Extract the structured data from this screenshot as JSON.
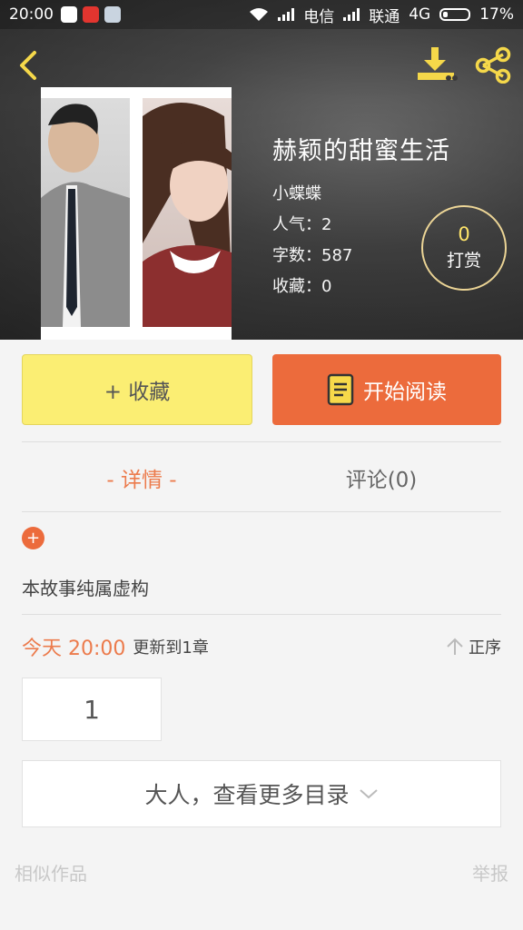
{
  "status_bar": {
    "time": "20:00",
    "carrier1": "电信",
    "carrier2": "联通",
    "network": "4G",
    "battery": "17%"
  },
  "book": {
    "title": "赫颖的甜蜜生活",
    "author": "小蝶蝶",
    "popularity": "人气：2",
    "word_count": "字数：587",
    "favorites": "收藏：0"
  },
  "reward": {
    "count": "0",
    "label": "打赏"
  },
  "actions": {
    "collect_label": "+ 收藏",
    "read_label": "开始阅读"
  },
  "tabs": [
    {
      "label": "- 详情 -"
    },
    {
      "label": "评论(0)"
    }
  ],
  "expand": {
    "symbol": "+"
  },
  "description": "本故事纯属虚构",
  "update": {
    "time": "今天 20:00",
    "text": "更新到1章",
    "order_label": "正序"
  },
  "chapter": {
    "number": "1"
  },
  "more_catalog": "大人，查看更多目录",
  "footer": {
    "similar": "相似作品",
    "report": "举报"
  },
  "colors": {
    "accent": "#ec6b3c",
    "collect": "#fbee73",
    "icon_yellow": "#f5d84a"
  }
}
